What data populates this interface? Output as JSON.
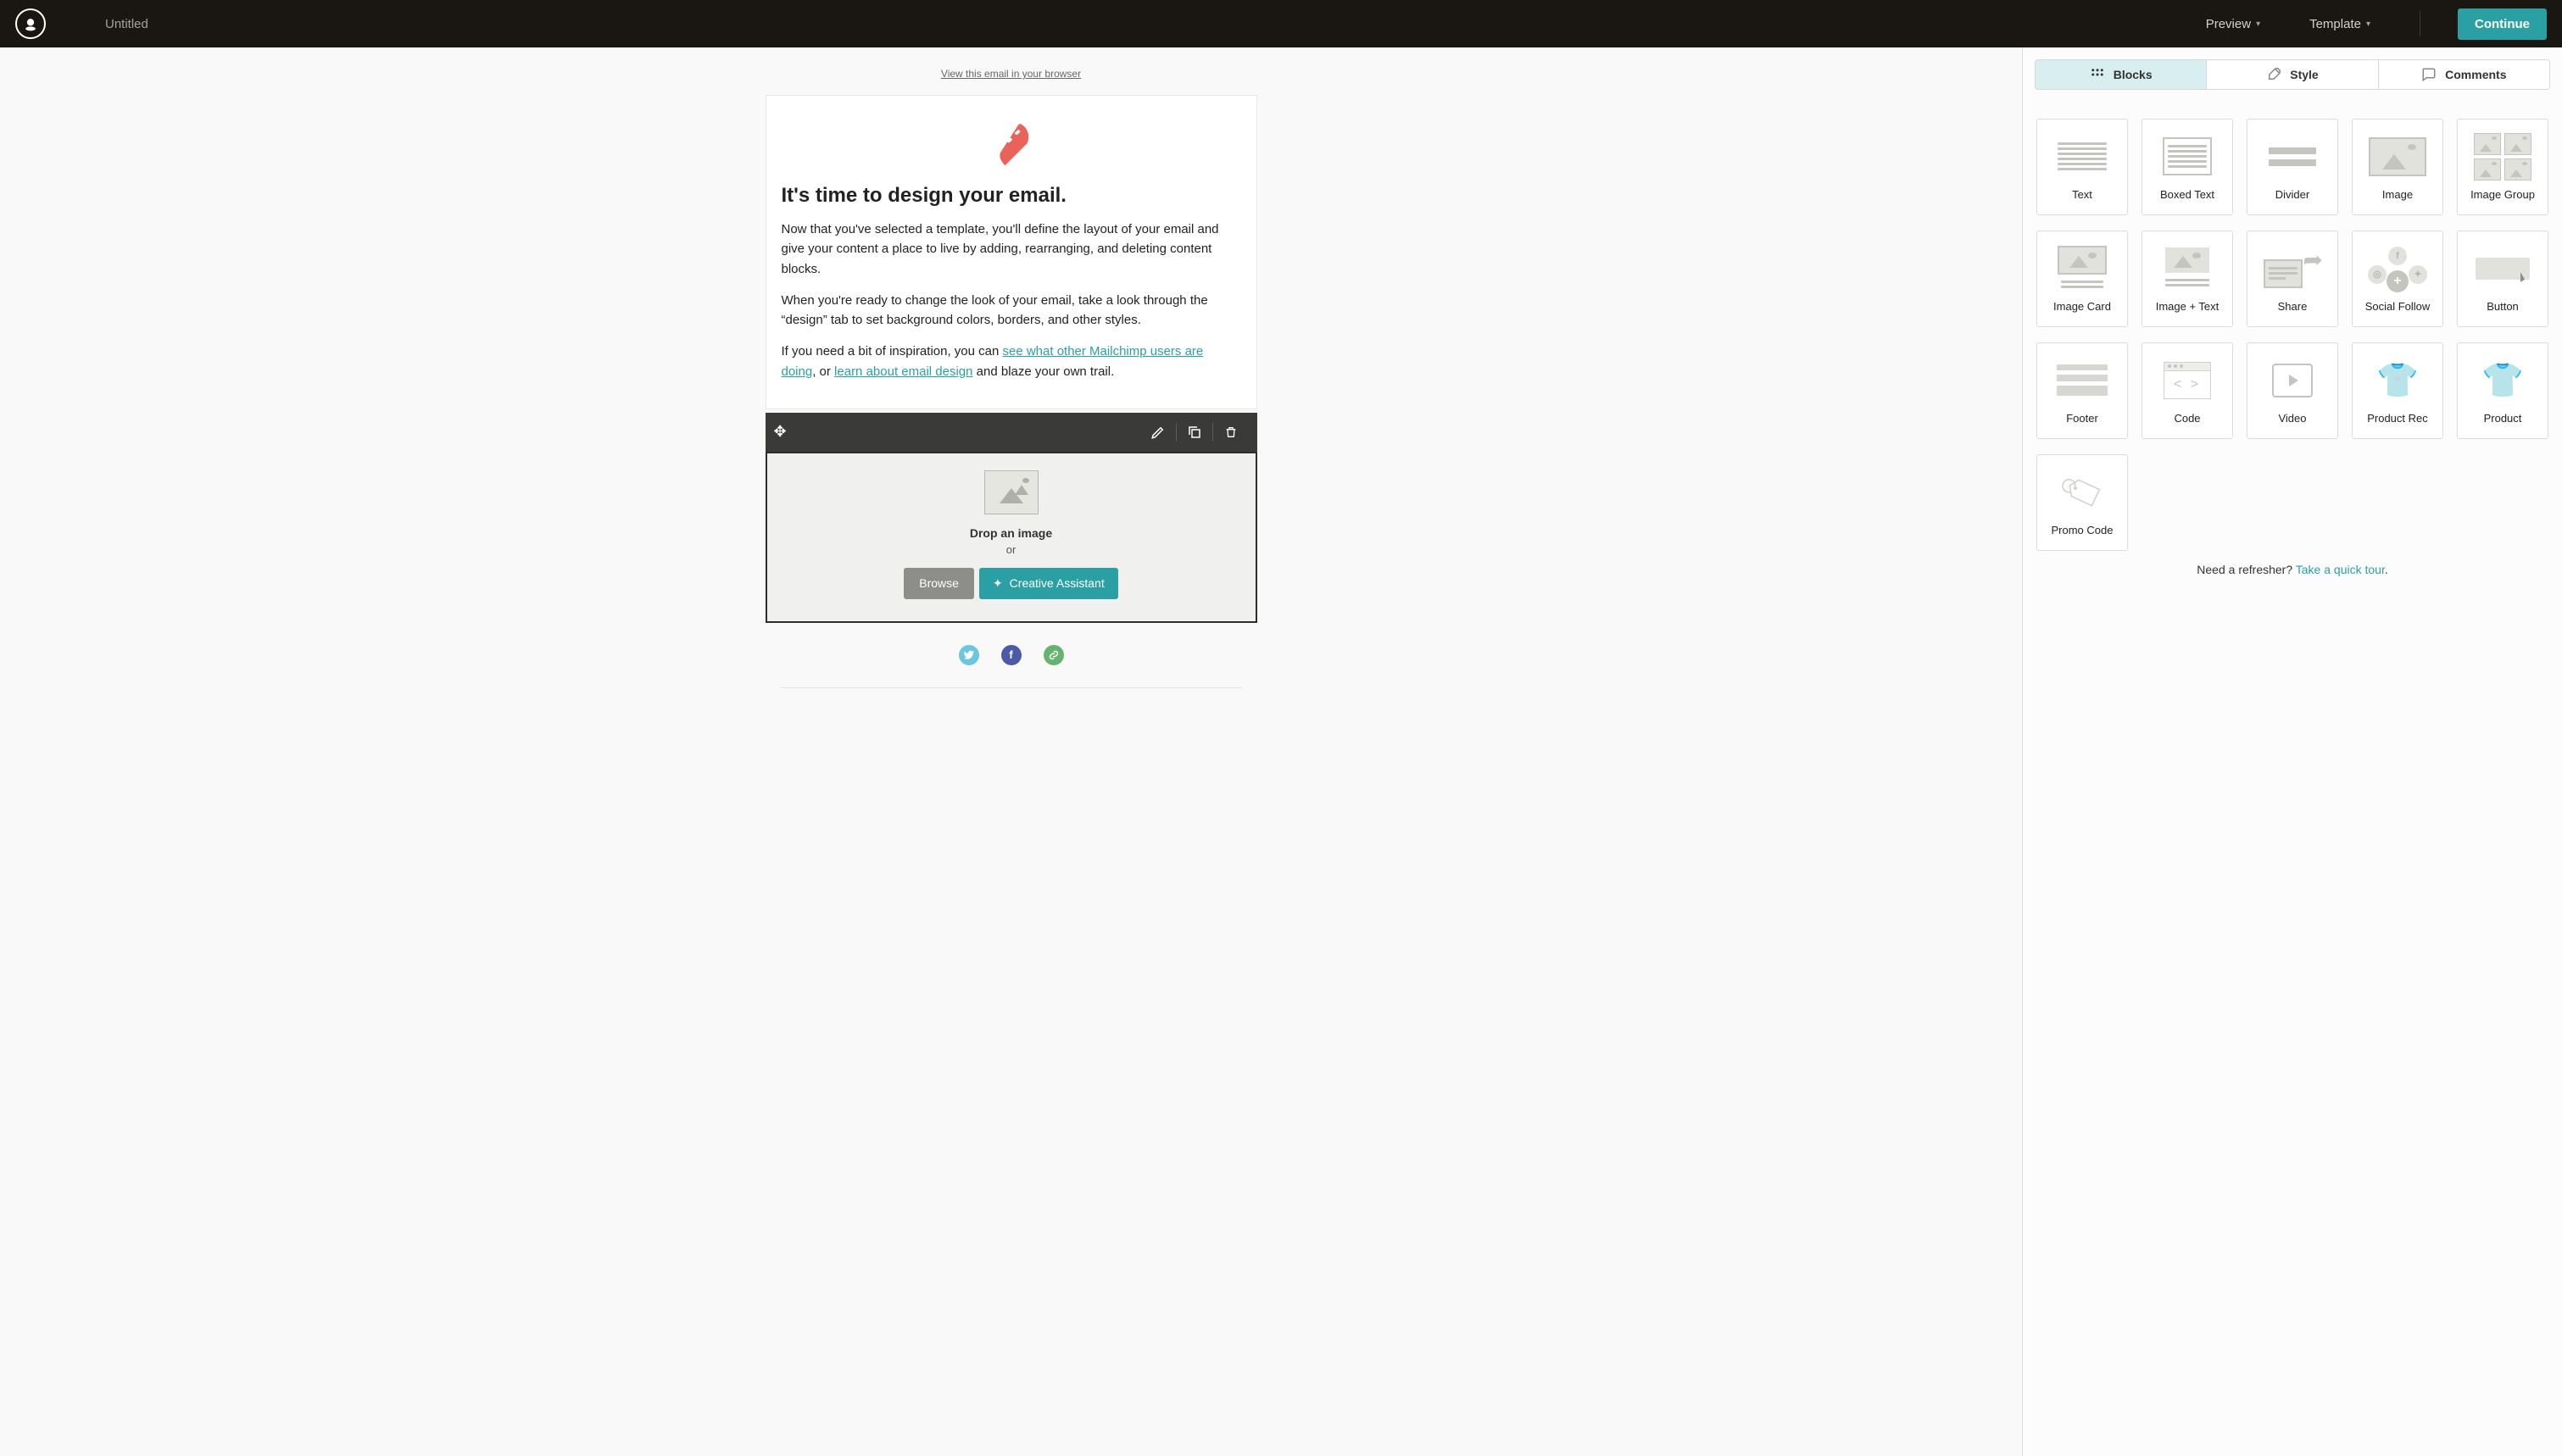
{
  "header": {
    "title": "Untitled",
    "preview": "Preview",
    "template": "Template",
    "continue": "Continue"
  },
  "canvas": {
    "view_in_browser": "View this email in your browser",
    "heading": "It's time to design your email.",
    "p1": "Now that you've selected a template, you'll define the layout of your email and give your content a place to live by adding, rearranging, and deleting content blocks.",
    "p2": "When you're ready to change the look of your email, take a look through the “design” tab to set background colors, borders, and other styles.",
    "p3_pre": "If you need a bit of inspiration, you can ",
    "p3_link1": "see what other Mailchimp users are doing",
    "p3_mid": ", or ",
    "p3_link2": "learn about email design",
    "p3_post": " and blaze your own trail.",
    "drop_title": "Drop an image",
    "drop_or": "or",
    "browse_btn": "Browse",
    "creative_btn": "Creative Assistant"
  },
  "sidebar": {
    "tabs": {
      "blocks": "Blocks",
      "style": "Style",
      "comments": "Comments"
    },
    "blocks": [
      "Text",
      "Boxed Text",
      "Divider",
      "Image",
      "Image Group",
      "Image Card",
      "Image + Text",
      "Share",
      "Social Follow",
      "Button",
      "Footer",
      "Code",
      "Video",
      "Product Rec",
      "Product",
      "Promo Code"
    ],
    "refresher_pre": "Need a refresher? ",
    "refresher_link": "Take a quick tour",
    "refresher_post": "."
  }
}
